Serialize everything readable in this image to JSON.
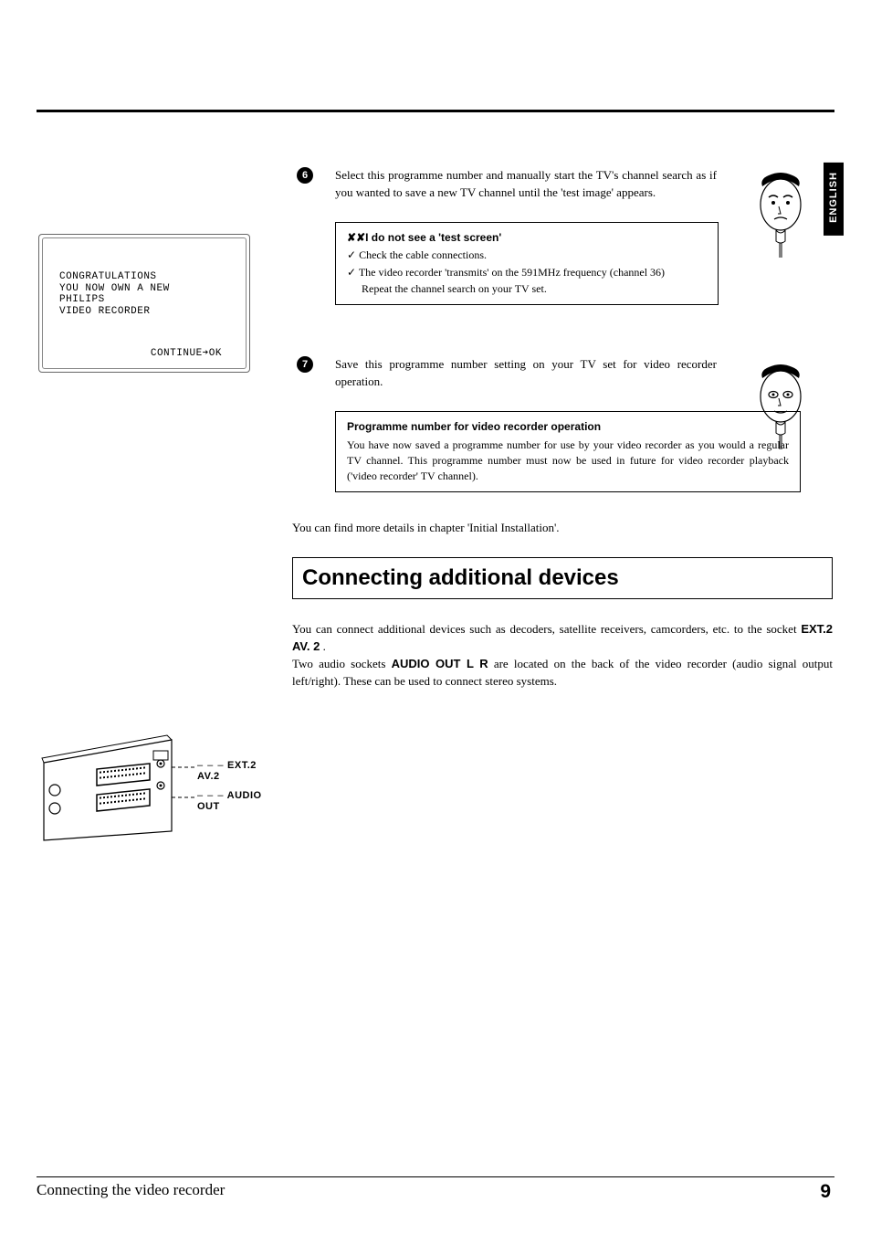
{
  "language_tab": "ENGLISH",
  "tv": {
    "line1": "CONGRATULATIONS",
    "line2": "YOU NOW OWN A NEW",
    "line3": "PHILIPS",
    "line4": "VIDEO RECORDER",
    "continue": "CONTINUE➔OK"
  },
  "step6": {
    "num": "6",
    "text": "Select this programme number and manually start the TV's channel search as if you wanted to save a new TV channel until the 'test image' appears.",
    "box_title": "I do not see a 'test screen'",
    "bullet1": "Check the cable connections.",
    "bullet2_a": "The video recorder 'transmits' on the 591MHz frequency (channel 36)",
    "bullet2_b": "Repeat the channel search on your TV set."
  },
  "step7": {
    "num": "7",
    "text": "Save this programme number setting on your TV set for video recorder operation.",
    "box_title": "Programme number for video recorder operation",
    "box_body": "You have now saved a programme number for use by your video recorder as you would a regular TV channel. This programme number must now be used in future for video recorder playback ('video recorder' TV channel)."
  },
  "more_details": "You can find more details in chapter 'Initial Installation'.",
  "section_heading": "Connecting additional devices",
  "section_body": {
    "p1a": "You can connect additional devices such as decoders, satellite receivers, camcorders, etc. to the socket ",
    "p1b": "EXT.2 AV. 2",
    "p1c": " .",
    "p2a": "Two audio sockets ",
    "p2b": "AUDIO OUT L R",
    "p2c": " are located on the back of the video recorder (audio signal output left/right). These can be used to connect stereo systems."
  },
  "diagram": {
    "label1_dash": "– – –",
    "label1": "EXT.2 AV.2",
    "label2_dash": "– – –",
    "label2": "AUDIO OUT"
  },
  "footer": {
    "left": "Connecting the video recorder",
    "page": "9"
  }
}
